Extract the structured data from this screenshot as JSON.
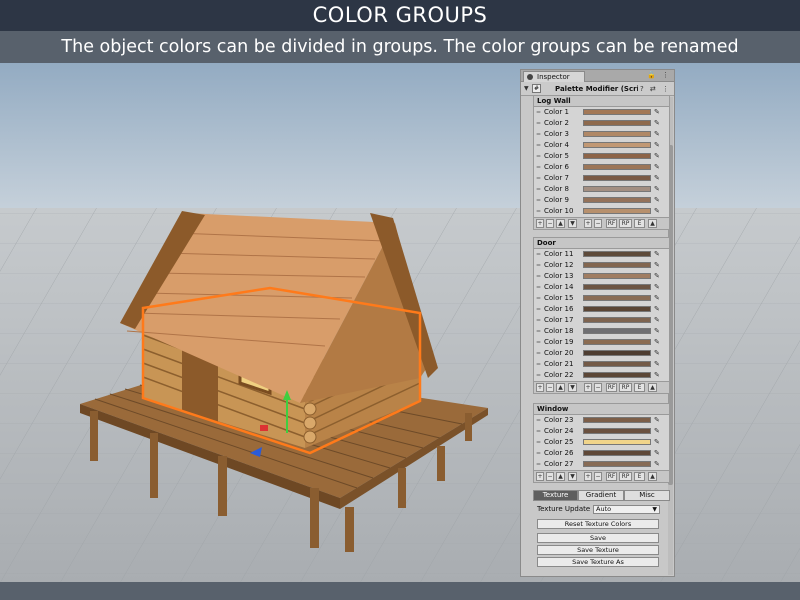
{
  "banner": {
    "title": "COLOR GROUPS",
    "subtitle": "The object colors can be divided in groups. The color groups can be renamed"
  },
  "inspector": {
    "tab_label": "Inspector",
    "tab_icons": "🔒 ⋮",
    "component_title": "Palette Modifier (Script",
    "component_icons": "? ⇄ ⋮",
    "groups": [
      {
        "name": "Log Wall",
        "colors": [
          {
            "label": "Color 1",
            "swatch": "#a37856"
          },
          {
            "label": "Color 2",
            "swatch": "#8e6a4d"
          },
          {
            "label": "Color 3",
            "swatch": "#b08866"
          },
          {
            "label": "Color 4",
            "swatch": "#c19874"
          },
          {
            "label": "Color 5",
            "swatch": "#8d6448"
          },
          {
            "label": "Color 6",
            "swatch": "#9c7658"
          },
          {
            "label": "Color 7",
            "swatch": "#7a5a45"
          },
          {
            "label": "Color 8",
            "swatch": "#a38f82"
          },
          {
            "label": "Color 9",
            "swatch": "#94725a"
          },
          {
            "label": "Color 10",
            "swatch": "#b7906d"
          }
        ]
      },
      {
        "name": "Door",
        "colors": [
          {
            "label": "Color 11",
            "swatch": "#5d4a3a"
          },
          {
            "label": "Color 12",
            "swatch": "#826650"
          },
          {
            "label": "Color 13",
            "swatch": "#a07d62"
          },
          {
            "label": "Color 14",
            "swatch": "#6c5442"
          },
          {
            "label": "Color 15",
            "swatch": "#8a6d56"
          },
          {
            "label": "Color 16",
            "swatch": "#5a4535"
          },
          {
            "label": "Color 17",
            "swatch": "#7e6450"
          },
          {
            "label": "Color 18",
            "swatch": "#6f6f72"
          },
          {
            "label": "Color 19",
            "swatch": "#8b6c52"
          },
          {
            "label": "Color 20",
            "swatch": "#4e3d31"
          },
          {
            "label": "Color 21",
            "swatch": "#735a47"
          },
          {
            "label": "Color 22",
            "swatch": "#5b4636"
          }
        ]
      },
      {
        "name": "Window",
        "colors": [
          {
            "label": "Color 23",
            "swatch": "#7c5e48"
          },
          {
            "label": "Color 24",
            "swatch": "#6a503e"
          },
          {
            "label": "Color 25",
            "swatch": "#f0d48a"
          },
          {
            "label": "Color 26",
            "swatch": "#5f4837"
          },
          {
            "label": "Color 27",
            "swatch": "#876b55"
          }
        ]
      }
    ],
    "footer_buttons": [
      "+",
      "−",
      "▲",
      "▼",
      "+",
      "−",
      "RF",
      "RP",
      "E",
      "▲"
    ],
    "tabs": [
      {
        "label": "Texture",
        "active": true
      },
      {
        "label": "Gradient",
        "active": false
      },
      {
        "label": "Misc",
        "active": false
      }
    ],
    "texture_update": {
      "label": "Texture Update",
      "value": "Auto"
    },
    "buttons": {
      "reset": "Reset Texture Colors",
      "save": "Save",
      "save_texture": "Save Texture",
      "save_texture_as": "Save Texture As"
    }
  },
  "colors": {
    "banner_dark": "#2d3645",
    "banner_light": "#58616c",
    "selection_outline": "#ff7a1a",
    "sky": "#9fb5c9",
    "ground": "#b5b9bd"
  }
}
